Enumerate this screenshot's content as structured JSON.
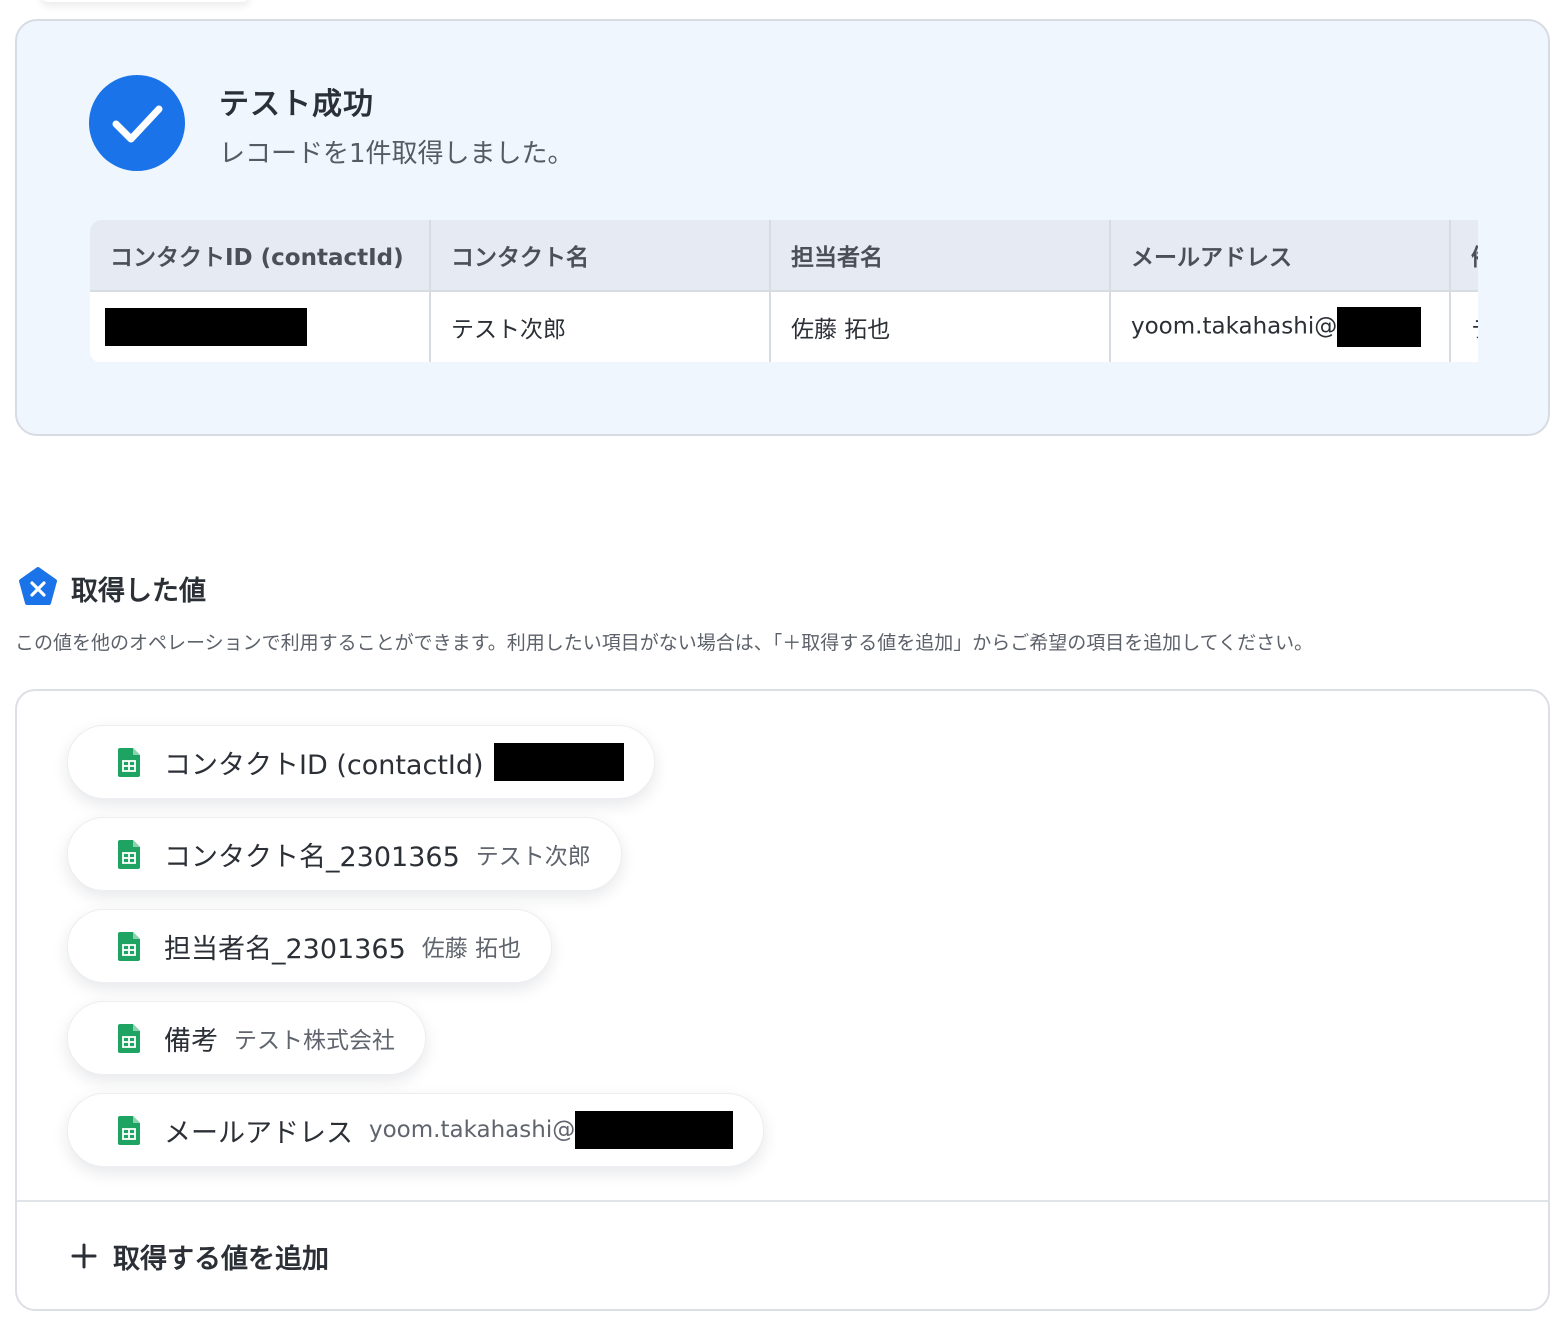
{
  "result": {
    "title": "テスト成功",
    "message": "レコードを1件取得しました。",
    "icon": "check-circle-icon",
    "accent_color": "#1a73e8",
    "table": {
      "headers": [
        "コンタクトID (contactId)",
        "コンタクト名",
        "担当者名",
        "メールアドレス",
        "備考"
      ],
      "row": {
        "contact_id": "",
        "contact_name": "テスト次郎",
        "owner_name": "佐藤 拓也",
        "email": "yoom.takahashi@",
        "note": "テスト株式会社"
      }
    }
  },
  "retrieved": {
    "icon": "variable-icon",
    "title": "取得した値",
    "description": "この値を他のオペレーションで利用することができます。利用したい項目がない場合は、「＋取得する値を追加」からご希望の項目を追加してください。",
    "items": [
      {
        "label": "コンタクトID (contactId)",
        "value": "",
        "icon": "google-sheets-icon"
      },
      {
        "label": "コンタクト名_2301365",
        "value": "テスト次郎",
        "icon": "google-sheets-icon"
      },
      {
        "label": "担当者名_2301365",
        "value": "佐藤 拓也",
        "icon": "google-sheets-icon"
      },
      {
        "label": "備考",
        "value": "テスト株式会社",
        "icon": "google-sheets-icon"
      },
      {
        "label": "メールアドレス",
        "value": "yoom.takahashi@",
        "icon": "google-sheets-icon"
      }
    ],
    "add_button_label": "取得する値を追加",
    "sheet_icon_color": "#1ea362"
  }
}
